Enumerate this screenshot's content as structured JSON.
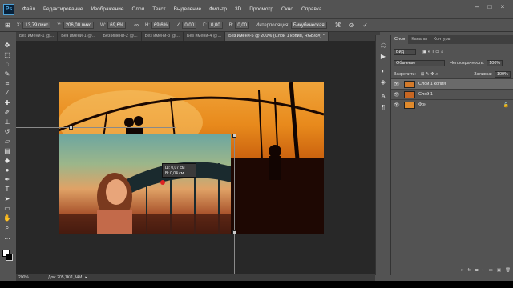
{
  "menu": [
    "Файл",
    "Редактирование",
    "Изображение",
    "Слои",
    "Текст",
    "Выделение",
    "Фильтр",
    "3D",
    "Просмотр",
    "Окно",
    "Справка"
  ],
  "app_logo": "Ps",
  "window_controls": [
    "–",
    "□",
    "×"
  ],
  "options": {
    "x_label": "X:",
    "x_value": "13,79 пикс",
    "y_label": "Y:",
    "y_value": "206,00 пикс",
    "w_label": "W:",
    "w_value": "69,6%",
    "h_label": "H:",
    "h_value": "69,6%",
    "angle_value": "0,00",
    "hskew_label": "Г:",
    "hskew_value": "0,00",
    "vskew_label": "В:",
    "vskew_value": "0,00",
    "interp_label": "Интерполяция:",
    "interp_value": "Бикубическая"
  },
  "tabs": [
    {
      "label": "Без имени-1 @...",
      "active": false
    },
    {
      "label": "Без имени-1 @...",
      "active": false
    },
    {
      "label": "Без имени-2 @...",
      "active": false
    },
    {
      "label": "Без имени-3 @...",
      "active": false
    },
    {
      "label": "Без имени-4 @...",
      "active": false
    },
    {
      "label": "Без имени-5 @ 200% (Слой 1 копия, RGB/8#) *",
      "active": true
    }
  ],
  "tooltip": {
    "line1": "Ш: 0,07 см",
    "line2": "В: 0,04 см"
  },
  "status": {
    "zoom": "200%",
    "doc": "Док: 205,1K/1,34M"
  },
  "panel": {
    "tabs": [
      "Слои",
      "Каналы",
      "Контуры"
    ],
    "kind_label": "Вид",
    "mode": "Обычные",
    "opacity_label": "Непрозрачность:",
    "opacity_value": "100%",
    "lock_label": "Закрепить:",
    "fill_label": "Заливка:",
    "fill_value": "100%",
    "layers": [
      {
        "name": "Слой 1 копия",
        "selected": true,
        "locked": false,
        "thumb_color": "#d47a2a"
      },
      {
        "name": "Слой 1",
        "selected": false,
        "locked": false,
        "thumb_color": "#c76622"
      },
      {
        "name": "Фон",
        "selected": false,
        "locked": true,
        "thumb_color": "#e08a2c"
      }
    ]
  },
  "colors": {
    "foreground": "#ffffff",
    "background": "#000000",
    "accent": "#4fa3d8"
  }
}
